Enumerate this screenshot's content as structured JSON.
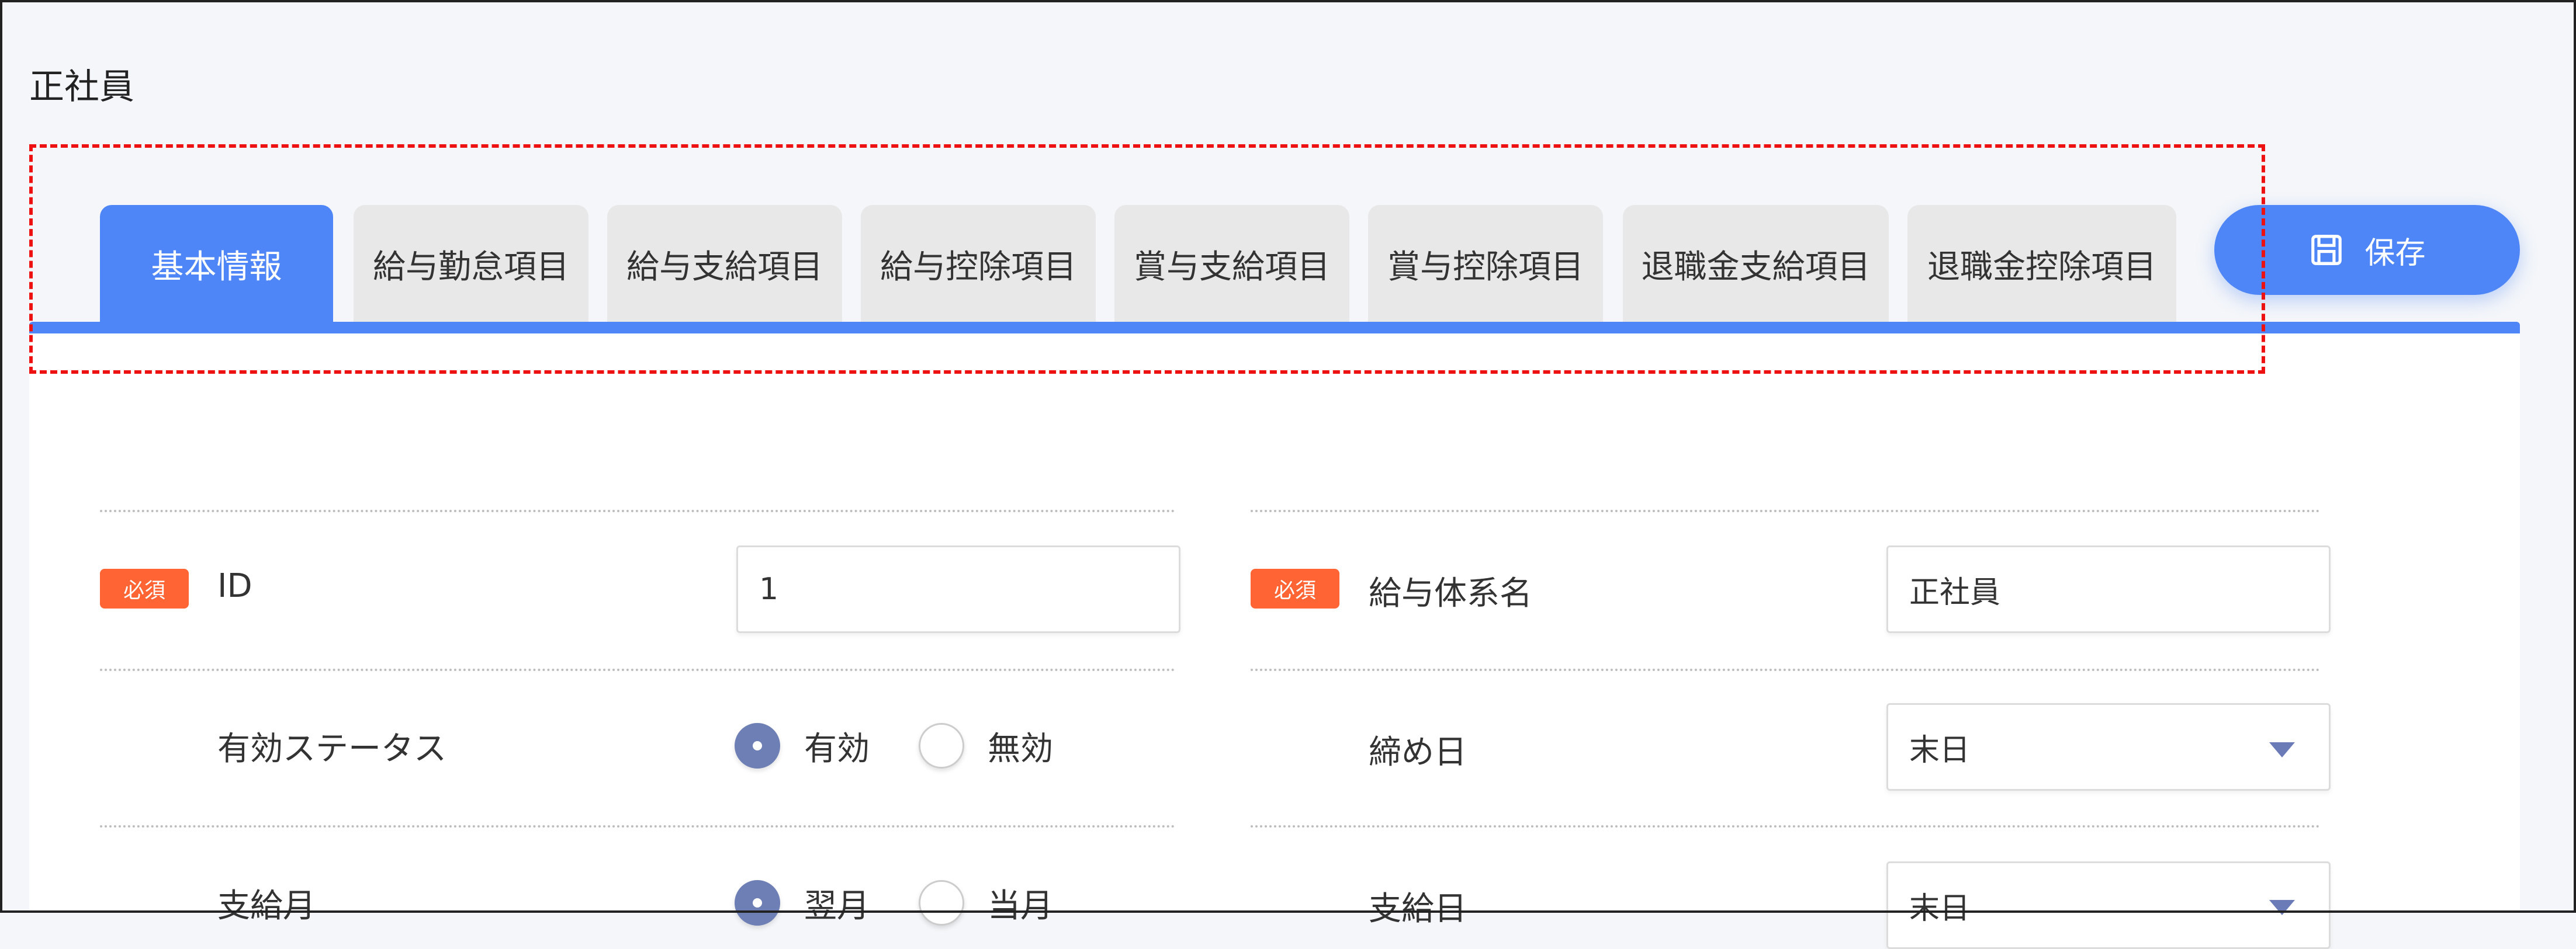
{
  "page": {
    "title": "正社員"
  },
  "tabs": [
    {
      "label": "基本情報",
      "active": true
    },
    {
      "label": "給与勤怠項目"
    },
    {
      "label": "給与支給項目"
    },
    {
      "label": "給与控除項目"
    },
    {
      "label": "賞与支給項目"
    },
    {
      "label": "賞与控除項目"
    },
    {
      "label": "退職金支給項目"
    },
    {
      "label": "退職金控除項目"
    }
  ],
  "toolbar": {
    "save_label": "保存",
    "save_icon": "save-icon"
  },
  "form": {
    "required_badge": "必須",
    "id": {
      "label": "ID",
      "value": "1"
    },
    "salary_system_name": {
      "label": "給与体系名",
      "value": "正社員"
    },
    "status": {
      "label": "有効ステータス",
      "options": [
        "有効",
        "無効"
      ],
      "selected": "有効"
    },
    "closing_day": {
      "label": "締め日",
      "value": "末日"
    },
    "pay_month": {
      "label": "支給月",
      "options": [
        "翌月",
        "当月"
      ],
      "selected": "翌月"
    },
    "pay_day": {
      "label": "支給日",
      "value": "末日"
    }
  },
  "colors": {
    "accent": "#4f86f7",
    "badge": "#ff6434",
    "radio": "#6d7fb5"
  }
}
